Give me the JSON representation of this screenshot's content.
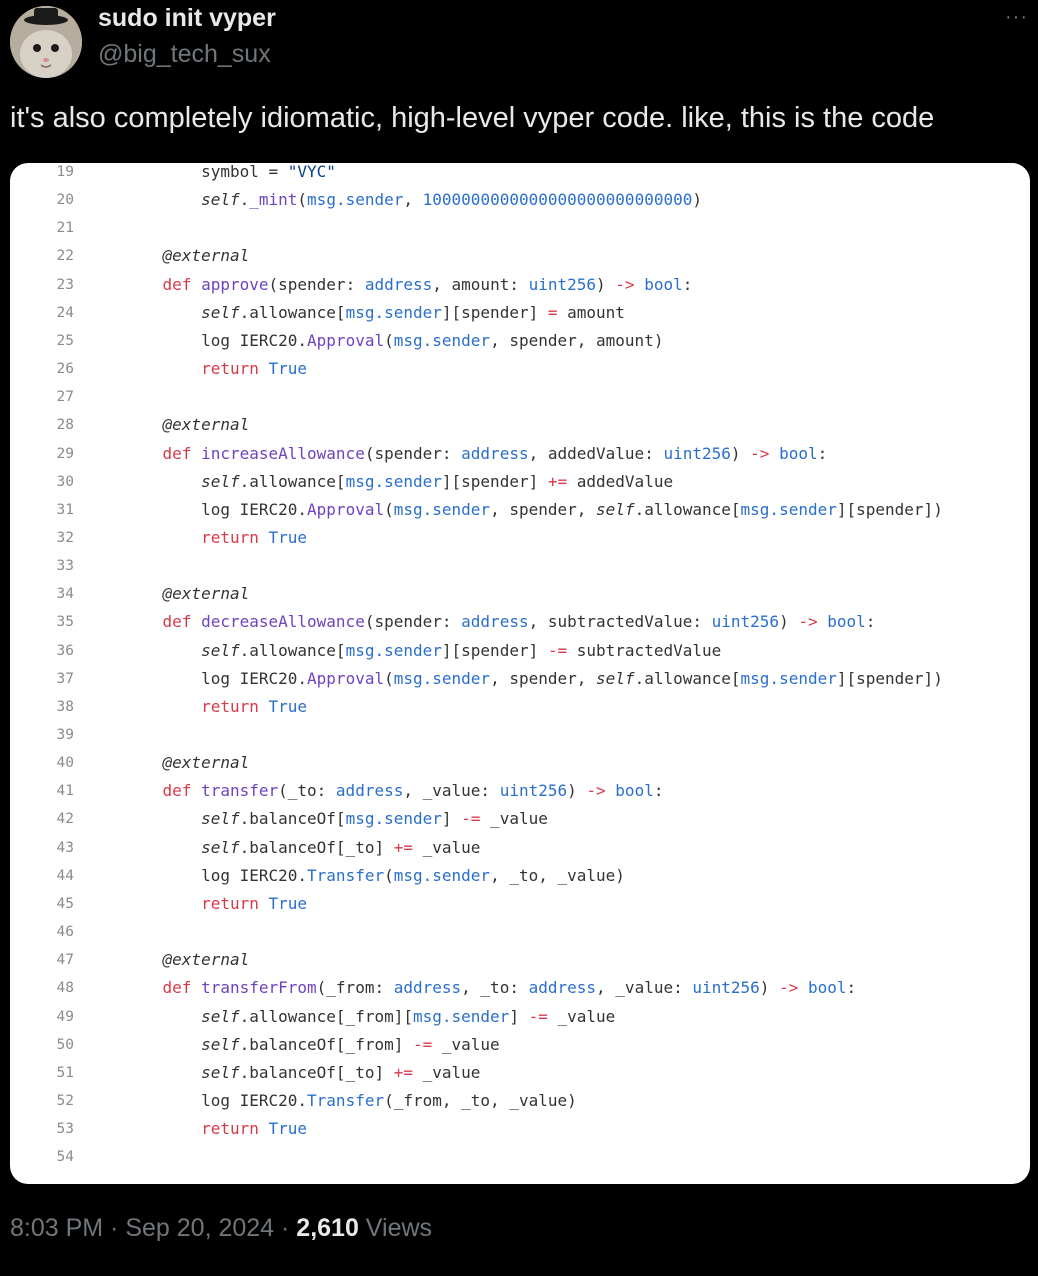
{
  "author": {
    "display_name": "sudo init vyper",
    "handle": "@big_tech_sux"
  },
  "more_label": "···",
  "tweet_text": "it's also completely idiomatic, high-level vyper code. like, this is the code",
  "code": {
    "lines": [
      {
        "n": "19",
        "t": [
          [
            "        ",
            "default"
          ],
          [
            "symbol = ",
            "default"
          ],
          [
            "\"VYC\"",
            "str"
          ]
        ]
      },
      {
        "n": "20",
        "t": [
          [
            "        ",
            "default"
          ],
          [
            "self",
            "self"
          ],
          [
            ".",
            "default"
          ],
          [
            "_mint",
            "fn"
          ],
          [
            "(",
            "default"
          ],
          [
            "msg.sender",
            "type"
          ],
          [
            ", ",
            "default"
          ],
          [
            "1000000000000000000000000000",
            "num"
          ],
          [
            ")",
            "default"
          ]
        ]
      },
      {
        "n": "21",
        "t": []
      },
      {
        "n": "22",
        "t": [
          [
            "    ",
            "default"
          ],
          [
            "@external",
            "deco"
          ]
        ]
      },
      {
        "n": "23",
        "t": [
          [
            "    ",
            "default"
          ],
          [
            "def ",
            "kw"
          ],
          [
            "approve",
            "fn"
          ],
          [
            "(spender: ",
            "default"
          ],
          [
            "address",
            "type"
          ],
          [
            ", amount: ",
            "default"
          ],
          [
            "uint256",
            "type"
          ],
          [
            ") ",
            "default"
          ],
          [
            "->",
            "kw"
          ],
          [
            " ",
            "default"
          ],
          [
            "bool",
            "type"
          ],
          [
            ":",
            "default"
          ]
        ]
      },
      {
        "n": "24",
        "t": [
          [
            "        ",
            "default"
          ],
          [
            "self",
            "self"
          ],
          [
            ".allowance[",
            "default"
          ],
          [
            "msg.sender",
            "type"
          ],
          [
            "][spender] ",
            "default"
          ],
          [
            "=",
            "kw"
          ],
          [
            " amount",
            "default"
          ]
        ]
      },
      {
        "n": "25",
        "t": [
          [
            "        ",
            "default"
          ],
          [
            "log IERC20.",
            "default"
          ],
          [
            "Approval",
            "fn"
          ],
          [
            "(",
            "default"
          ],
          [
            "msg.sender",
            "type"
          ],
          [
            ", spender, amount)",
            "default"
          ]
        ]
      },
      {
        "n": "26",
        "t": [
          [
            "        ",
            "default"
          ],
          [
            "return ",
            "kw"
          ],
          [
            "True",
            "type"
          ]
        ]
      },
      {
        "n": "27",
        "t": []
      },
      {
        "n": "28",
        "t": [
          [
            "    ",
            "default"
          ],
          [
            "@external",
            "deco"
          ]
        ]
      },
      {
        "n": "29",
        "t": [
          [
            "    ",
            "default"
          ],
          [
            "def ",
            "kw"
          ],
          [
            "increaseAllowance",
            "fn"
          ],
          [
            "(spender: ",
            "default"
          ],
          [
            "address",
            "type"
          ],
          [
            ", addedValue: ",
            "default"
          ],
          [
            "uint256",
            "type"
          ],
          [
            ") ",
            "default"
          ],
          [
            "->",
            "kw"
          ],
          [
            " ",
            "default"
          ],
          [
            "bool",
            "type"
          ],
          [
            ":",
            "default"
          ]
        ]
      },
      {
        "n": "30",
        "t": [
          [
            "        ",
            "default"
          ],
          [
            "self",
            "self"
          ],
          [
            ".allowance[",
            "default"
          ],
          [
            "msg.sender",
            "type"
          ],
          [
            "][spender] ",
            "default"
          ],
          [
            "+=",
            "kw"
          ],
          [
            " addedValue",
            "default"
          ]
        ]
      },
      {
        "n": "31",
        "t": [
          [
            "        ",
            "default"
          ],
          [
            "log IERC20.",
            "default"
          ],
          [
            "Approval",
            "fn"
          ],
          [
            "(",
            "default"
          ],
          [
            "msg.sender",
            "type"
          ],
          [
            ", spender, ",
            "default"
          ],
          [
            "self",
            "self"
          ],
          [
            ".allowance[",
            "default"
          ],
          [
            "msg.sender",
            "type"
          ],
          [
            "][spender])",
            "default"
          ]
        ]
      },
      {
        "n": "32",
        "t": [
          [
            "        ",
            "default"
          ],
          [
            "return ",
            "kw"
          ],
          [
            "True",
            "type"
          ]
        ]
      },
      {
        "n": "33",
        "t": []
      },
      {
        "n": "34",
        "t": [
          [
            "    ",
            "default"
          ],
          [
            "@external",
            "deco"
          ]
        ]
      },
      {
        "n": "35",
        "t": [
          [
            "    ",
            "default"
          ],
          [
            "def ",
            "kw"
          ],
          [
            "decreaseAllowance",
            "fn"
          ],
          [
            "(spender: ",
            "default"
          ],
          [
            "address",
            "type"
          ],
          [
            ", subtractedValue: ",
            "default"
          ],
          [
            "uint256",
            "type"
          ],
          [
            ") ",
            "default"
          ],
          [
            "->",
            "kw"
          ],
          [
            " ",
            "default"
          ],
          [
            "bool",
            "type"
          ],
          [
            ":",
            "default"
          ]
        ]
      },
      {
        "n": "36",
        "t": [
          [
            "        ",
            "default"
          ],
          [
            "self",
            "self"
          ],
          [
            ".allowance[",
            "default"
          ],
          [
            "msg.sender",
            "type"
          ],
          [
            "][spender] ",
            "default"
          ],
          [
            "-=",
            "kw"
          ],
          [
            " subtractedValue",
            "default"
          ]
        ]
      },
      {
        "n": "37",
        "t": [
          [
            "        ",
            "default"
          ],
          [
            "log IERC20.",
            "default"
          ],
          [
            "Approval",
            "fn"
          ],
          [
            "(",
            "default"
          ],
          [
            "msg.sender",
            "type"
          ],
          [
            ", spender, ",
            "default"
          ],
          [
            "self",
            "self"
          ],
          [
            ".allowance[",
            "default"
          ],
          [
            "msg.sender",
            "type"
          ],
          [
            "][spender])",
            "default"
          ]
        ]
      },
      {
        "n": "38",
        "t": [
          [
            "        ",
            "default"
          ],
          [
            "return ",
            "kw"
          ],
          [
            "True",
            "type"
          ]
        ]
      },
      {
        "n": "39",
        "t": []
      },
      {
        "n": "40",
        "t": [
          [
            "    ",
            "default"
          ],
          [
            "@external",
            "deco"
          ]
        ]
      },
      {
        "n": "41",
        "t": [
          [
            "    ",
            "default"
          ],
          [
            "def ",
            "kw"
          ],
          [
            "transfer",
            "fn"
          ],
          [
            "(_to: ",
            "default"
          ],
          [
            "address",
            "type"
          ],
          [
            ", _value: ",
            "default"
          ],
          [
            "uint256",
            "type"
          ],
          [
            ") ",
            "default"
          ],
          [
            "->",
            "kw"
          ],
          [
            " ",
            "default"
          ],
          [
            "bool",
            "type"
          ],
          [
            ":",
            "default"
          ]
        ]
      },
      {
        "n": "42",
        "t": [
          [
            "        ",
            "default"
          ],
          [
            "self",
            "self"
          ],
          [
            ".balanceOf[",
            "default"
          ],
          [
            "msg.sender",
            "type"
          ],
          [
            "] ",
            "default"
          ],
          [
            "-=",
            "kw"
          ],
          [
            " _value",
            "default"
          ]
        ]
      },
      {
        "n": "43",
        "t": [
          [
            "        ",
            "default"
          ],
          [
            "self",
            "self"
          ],
          [
            ".balanceOf[_to] ",
            "default"
          ],
          [
            "+=",
            "kw"
          ],
          [
            " _value",
            "default"
          ]
        ]
      },
      {
        "n": "44",
        "t": [
          [
            "        ",
            "default"
          ],
          [
            "log IERC20.",
            "default"
          ],
          [
            "Transfer",
            "type"
          ],
          [
            "(",
            "default"
          ],
          [
            "msg.sender",
            "type"
          ],
          [
            ", _to, _value)",
            "default"
          ]
        ]
      },
      {
        "n": "45",
        "t": [
          [
            "        ",
            "default"
          ],
          [
            "return ",
            "kw"
          ],
          [
            "True",
            "type"
          ]
        ]
      },
      {
        "n": "46",
        "t": []
      },
      {
        "n": "47",
        "t": [
          [
            "    ",
            "default"
          ],
          [
            "@external",
            "deco"
          ]
        ]
      },
      {
        "n": "48",
        "t": [
          [
            "    ",
            "default"
          ],
          [
            "def ",
            "kw"
          ],
          [
            "transferFrom",
            "fn"
          ],
          [
            "(_from: ",
            "default"
          ],
          [
            "address",
            "type"
          ],
          [
            ", _to: ",
            "default"
          ],
          [
            "address",
            "type"
          ],
          [
            ", _value: ",
            "default"
          ],
          [
            "uint256",
            "type"
          ],
          [
            ") ",
            "default"
          ],
          [
            "->",
            "kw"
          ],
          [
            " ",
            "default"
          ],
          [
            "bool",
            "type"
          ],
          [
            ":",
            "default"
          ]
        ]
      },
      {
        "n": "49",
        "t": [
          [
            "        ",
            "default"
          ],
          [
            "self",
            "self"
          ],
          [
            ".allowance[_from][",
            "default"
          ],
          [
            "msg.sender",
            "type"
          ],
          [
            "] ",
            "default"
          ],
          [
            "-=",
            "kw"
          ],
          [
            " _value",
            "default"
          ]
        ]
      },
      {
        "n": "50",
        "t": [
          [
            "        ",
            "default"
          ],
          [
            "self",
            "self"
          ],
          [
            ".balanceOf[_from] ",
            "default"
          ],
          [
            "-=",
            "kw"
          ],
          [
            " _value",
            "default"
          ]
        ]
      },
      {
        "n": "51",
        "t": [
          [
            "        ",
            "default"
          ],
          [
            "self",
            "self"
          ],
          [
            ".balanceOf[_to] ",
            "default"
          ],
          [
            "+=",
            "kw"
          ],
          [
            " _value",
            "default"
          ]
        ]
      },
      {
        "n": "52",
        "t": [
          [
            "        ",
            "default"
          ],
          [
            "log IERC20.",
            "default"
          ],
          [
            "Transfer",
            "type"
          ],
          [
            "(_from, _to, _value)",
            "default"
          ]
        ]
      },
      {
        "n": "53",
        "t": [
          [
            "        ",
            "default"
          ],
          [
            "return ",
            "kw"
          ],
          [
            "True",
            "type"
          ]
        ]
      },
      {
        "n": "54",
        "t": []
      }
    ]
  },
  "meta": {
    "time": "8:03 PM",
    "separator": " · ",
    "date": "Sep 20, 2024",
    "separator2": " · ",
    "views_count": "2,610",
    "views_label": " Views"
  },
  "colors": {
    "background": "#000000",
    "text_primary": "#e7e9ea",
    "text_secondary": "#71767b",
    "code_keyword": "#d73a49",
    "code_function": "#6f42c1",
    "code_type": "#2a6fce"
  },
  "icons": {
    "avatar": "cat-with-hat-avatar",
    "more": "more-dots-icon"
  }
}
